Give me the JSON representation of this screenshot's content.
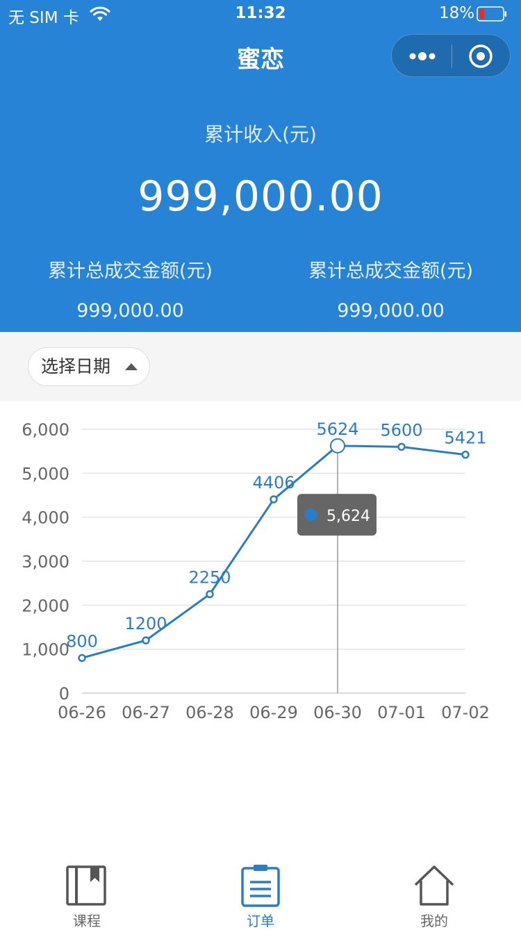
{
  "status_bar": {
    "carrier": "无 SIM 卡",
    "time": "11:32",
    "battery": "18%"
  },
  "nav": {
    "title": "蜜恋"
  },
  "summary": {
    "income_label": "累计收入(元)",
    "income_value": "999,000.00",
    "stats": [
      {
        "label": "累计总成交金额(元)",
        "value": "999,000.00"
      },
      {
        "label": "累计总成交金额(元)",
        "value": "999,000.00"
      }
    ]
  },
  "filter": {
    "date_button": "选择日期"
  },
  "chart_data": {
    "type": "line",
    "categories": [
      "06-26",
      "06-27",
      "06-28",
      "06-29",
      "06-30",
      "07-01",
      "07-02"
    ],
    "series": [
      {
        "values": [
          800,
          1200,
          2250,
          4406,
          5624,
          5600,
          5421
        ]
      }
    ],
    "y_ticks": [
      "0",
      "1,000",
      "2,000",
      "3,000",
      "4,000",
      "5,000",
      "6,000"
    ],
    "ylim": [
      0,
      6000
    ],
    "grid": true,
    "data_labels": [
      "800",
      "1200",
      "2250",
      "4406",
      "5624",
      "5600",
      "5421"
    ],
    "tooltip": {
      "category": "06-30",
      "value": "5,624"
    },
    "colors": {
      "line": "#2a7cc7",
      "tooltip_bg": "#666666"
    }
  },
  "tabs": [
    {
      "label": "课程",
      "icon": "book-icon",
      "active": false
    },
    {
      "label": "订单",
      "icon": "clipboard-icon",
      "active": true
    },
    {
      "label": "我的",
      "icon": "home-icon",
      "active": false
    }
  ],
  "colors": {
    "primary": "#2683d6",
    "active_tab": "#2a7cc7"
  }
}
